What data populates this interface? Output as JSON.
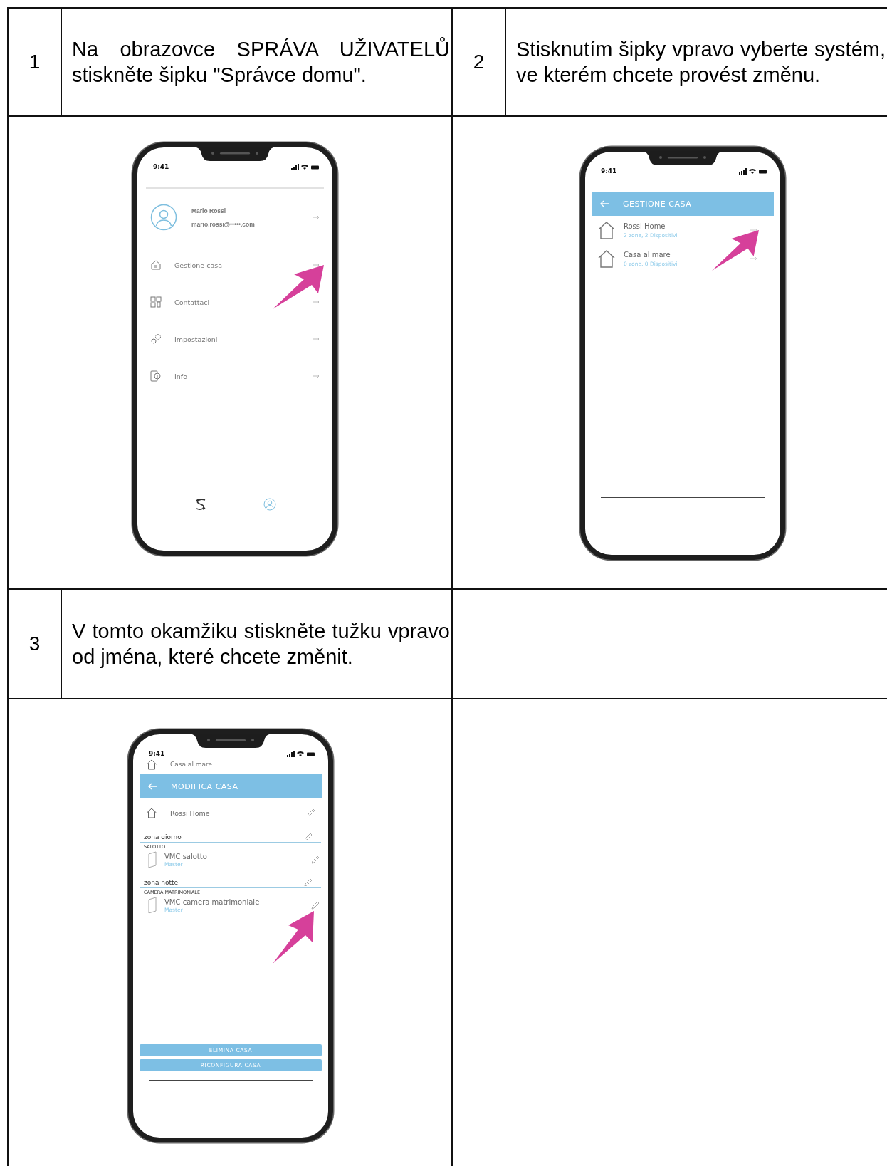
{
  "steps": [
    {
      "number": "1",
      "instruction": "Na obrazovce SPRÁVA UŽIVATELŮ stiskněte šipku \"Správce domu\".",
      "screen": {
        "kind": "profile_menu",
        "time": "9:41",
        "user_name": "Mario Rossi",
        "user_email": "mario.rossi@•••••.com",
        "items": [
          {
            "label": "Gestione casa",
            "pointed": true
          },
          {
            "label": "Contattaci",
            "pointed": false
          },
          {
            "label": "Impostazioni",
            "pointed": false
          },
          {
            "label": "Info",
            "pointed": false
          }
        ]
      }
    },
    {
      "number": "2",
      "instruction": "Stisknutím šipky vpravo vyberte systém, ve kterém chcete provést změnu.",
      "screen": {
        "kind": "house_list",
        "time": "9:41",
        "title": "GESTIONE CASA",
        "houses": [
          {
            "name": "Rossi Home",
            "detail": "2 zone, 2 Dispositivi",
            "pointed": true
          },
          {
            "name": "Casa al mare",
            "detail": "0 zone, 0 Dispositivi",
            "pointed": false
          }
        ]
      }
    },
    {
      "number": "3",
      "instruction": "V tomto okamžiku stiskněte tužku vpravo od jména, které chcete změnit.",
      "screen": {
        "kind": "edit_house",
        "time": "9:41",
        "current_house": "Casa al mare",
        "title": "MODIFICA CASA",
        "house_name": "Rossi Home",
        "zones": [
          {
            "name": "zona giorno",
            "room": "SALOTTO",
            "device": "VMC  salotto",
            "role": "Master",
            "pointed": false
          },
          {
            "name": "zona notte",
            "room": "CAMERA MATRIMONIALE",
            "device": "VMC  camera matrimoniale",
            "role": "Master",
            "pointed": true
          }
        ],
        "buttons": [
          "ELIMINA CASA",
          "RICONFIGURA CASA"
        ]
      }
    }
  ]
}
